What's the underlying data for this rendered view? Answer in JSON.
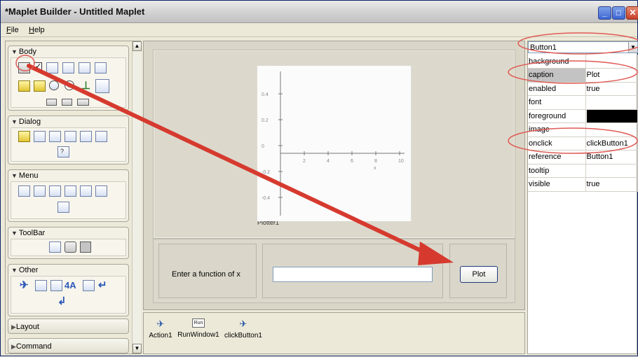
{
  "window": {
    "title": "*Maplet Builder - Untitled Maplet",
    "controls": [
      "minimize-icon",
      "maximize-icon",
      "close-icon"
    ]
  },
  "menu": [
    "File",
    "Help"
  ],
  "palette": {
    "groups": [
      {
        "label": "Body",
        "expanded": true
      },
      {
        "label": "Dialog",
        "expanded": true
      },
      {
        "label": "Menu",
        "expanded": true
      },
      {
        "label": "ToolBar",
        "expanded": true
      },
      {
        "label": "Other",
        "expanded": true
      },
      {
        "label": "Layout",
        "expanded": false
      },
      {
        "label": "Command",
        "expanded": false
      }
    ],
    "other_glyphs": [
      "4A"
    ]
  },
  "canvas": {
    "plot": {
      "y_ticks": [
        "0.4",
        "0.2",
        "0",
        "-0.2",
        "-0.4"
      ],
      "x_ticks": [
        "2",
        "4",
        "6",
        "8",
        "10"
      ],
      "x_label": "x",
      "caption": "Plotter1"
    },
    "label": "Enter a function of x",
    "textfield_value": "",
    "button_caption": "Plot"
  },
  "nonvisual": [
    {
      "label": "Action1",
      "icon": "action-icon"
    },
    {
      "label": "RunWindow1",
      "icon": "run-icon"
    },
    {
      "label": "clickButton1",
      "icon": "action-icon"
    }
  ],
  "properties": {
    "selected_element": "Button1",
    "rows": [
      {
        "key": "background",
        "value": ""
      },
      {
        "key": "caption",
        "value": "Plot"
      },
      {
        "key": "enabled",
        "value": "true"
      },
      {
        "key": "font",
        "value": ""
      },
      {
        "key": "foreground",
        "value": "",
        "swatch": "#000000"
      },
      {
        "key": "image",
        "value": ""
      },
      {
        "key": "onclick",
        "value": "clickButton1"
      },
      {
        "key": "reference",
        "value": "Button1"
      },
      {
        "key": "tooltip",
        "value": ""
      },
      {
        "key": "visible",
        "value": "true"
      }
    ]
  },
  "annotation": {
    "arrow_color": "#d63a2f",
    "circle_color": "#e05a55"
  },
  "run_icon_text": "Run"
}
